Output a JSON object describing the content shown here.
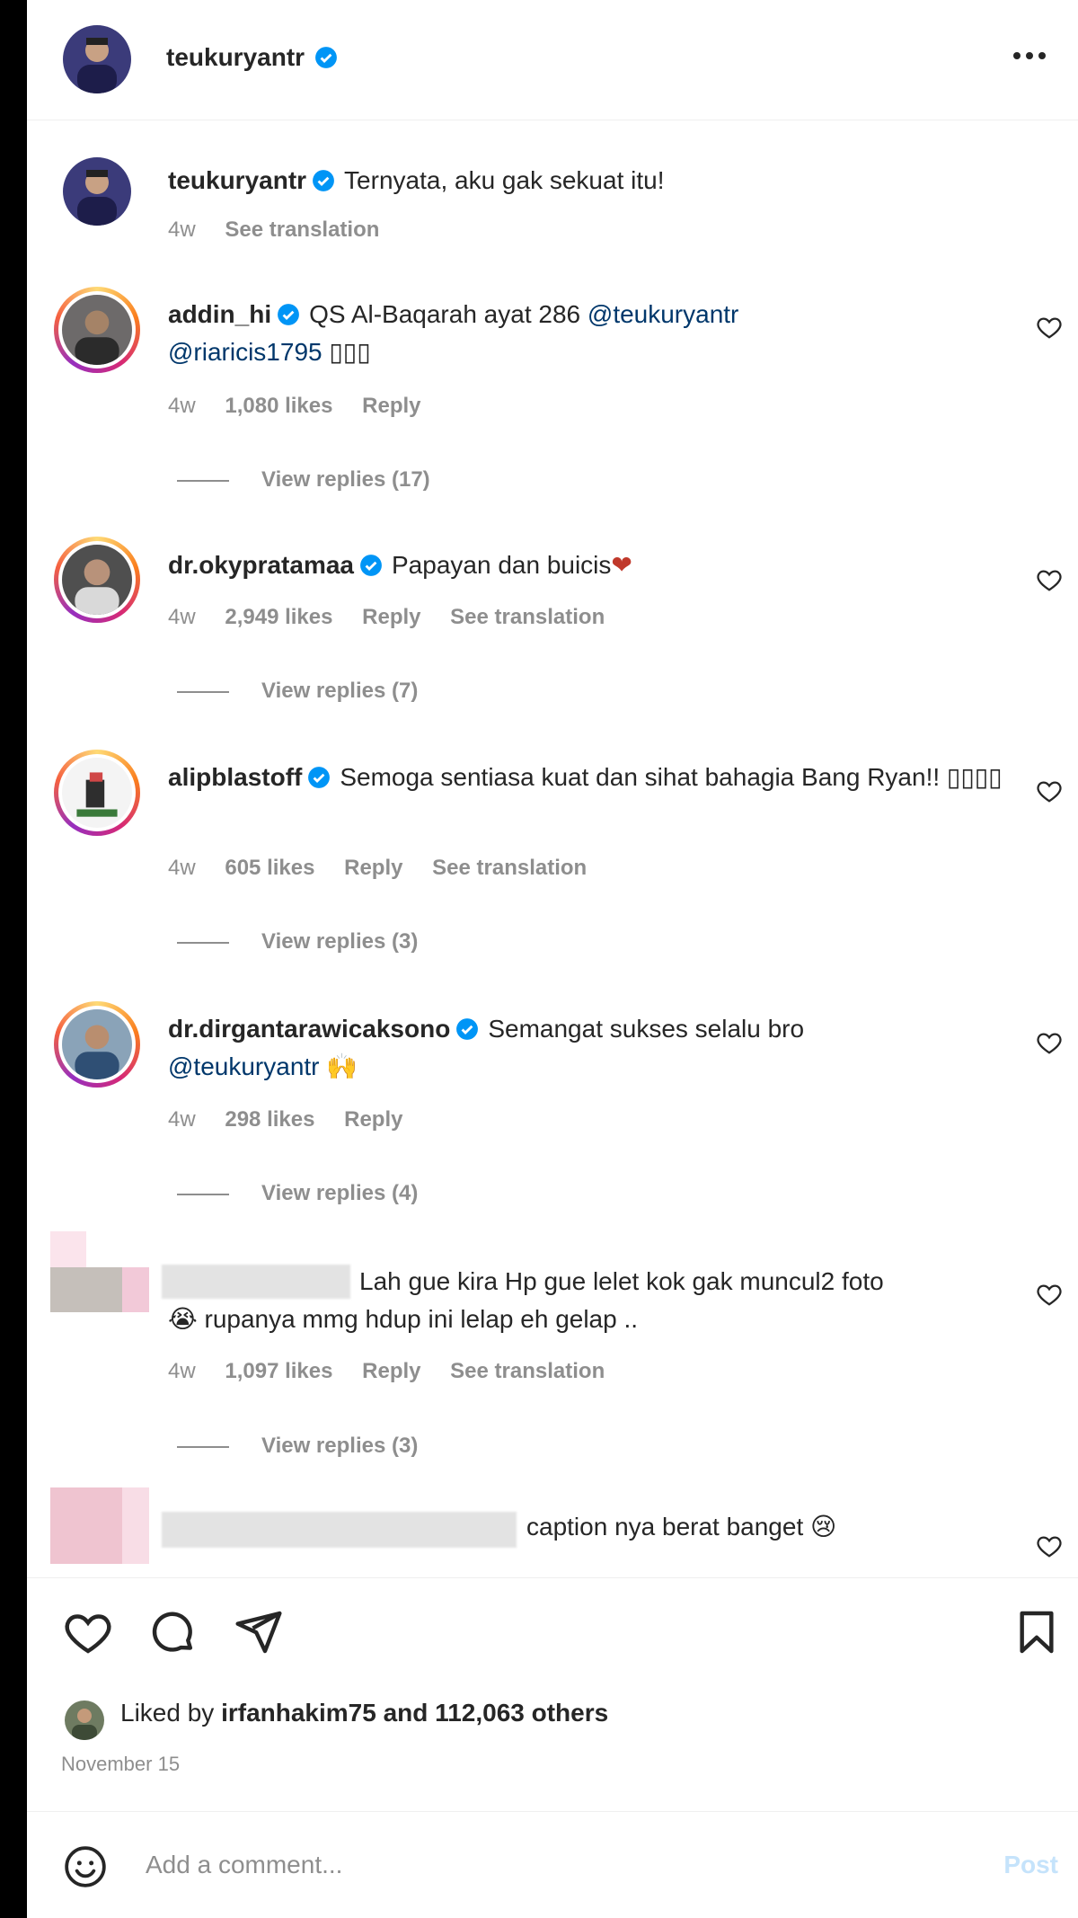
{
  "post": {
    "author": "teukuryantr",
    "caption": "Ternyata, aku gak sekuat itu!",
    "caption_time": "4w",
    "see_translation": "See translation"
  },
  "comments": [
    {
      "username": "addin_hi",
      "text": "QS Al-Baqarah ayat 286",
      "mentions": [
        "@teukuryantr",
        "@riaricis1795"
      ],
      "emoji": "▯▯▯",
      "time": "4w",
      "likes": "1,080 likes",
      "reply": "Reply",
      "view_replies": "View replies (17)"
    },
    {
      "username": "dr.okypratamaa",
      "text": "Papayan dan buicis",
      "emoji": "❤",
      "time": "4w",
      "likes": "2,949 likes",
      "reply": "Reply",
      "see_translation": "See translation",
      "view_replies": "View replies (7)"
    },
    {
      "username": "alipblastoff",
      "text": "Semoga sentiasa kuat dan sihat bahagia Bang Ryan!!",
      "emoji": "▯▯▯▯",
      "time": "4w",
      "likes": "605 likes",
      "reply": "Reply",
      "see_translation": "See translation",
      "view_replies": "View replies (3)"
    },
    {
      "username": "dr.dirgantarawicaksono",
      "text": "Semangat sukses selalu bro",
      "mentions": [
        "@teukuryantr"
      ],
      "emoji": "🙌",
      "time": "4w",
      "likes": "298 likes",
      "reply": "Reply",
      "view_replies": "View replies (4)"
    },
    {
      "text_line1": "Lah gue kira Hp gue lelet kok gak muncul2 foto",
      "text_line2": "rupanya mmg hdup ini lelap eh gelap ..",
      "emoji": "😭",
      "time": "4w",
      "likes": "1,097 likes",
      "reply": "Reply",
      "see_translation": "See translation",
      "view_replies": "View replies (3)"
    },
    {
      "text": "caption nya berat banget",
      "emoji": "😢"
    }
  ],
  "footer": {
    "liked_prefix": "Liked by",
    "liked_user": "irfanhakim75",
    "liked_and": "and",
    "liked_others": "112,063 others",
    "date": "November 15",
    "add_comment_placeholder": "Add a comment...",
    "post_button": "Post"
  },
  "colors": {
    "verified": "#0095f6",
    "mention": "#00376b",
    "meta_gray": "#8e8e8e",
    "post_disabled": "#c5e3fb"
  },
  "icons": [
    "more-options-icon",
    "verified-badge-icon",
    "heart-icon",
    "comment-icon",
    "share-icon",
    "bookmark-icon",
    "emoji-icon"
  ]
}
